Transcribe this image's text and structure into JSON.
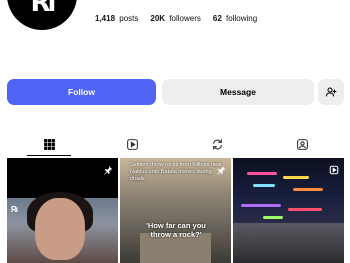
{
  "profile": {
    "avatar_text": "Rı",
    "stats": [
      {
        "value": "1,418",
        "label": "posts"
      },
      {
        "value": "20K",
        "label": "followers"
      },
      {
        "value": "62",
        "label": "following"
      }
    ]
  },
  "actions": {
    "follow_label": "Follow",
    "message_label": "Message"
  },
  "tabs": [
    {
      "icon": "grid-icon",
      "active": true
    },
    {
      "icon": "reels-icon",
      "active": false
    },
    {
      "icon": "reposts-icon",
      "active": false
    },
    {
      "icon": "tagged-icon",
      "active": false
    }
  ],
  "posts": [
    {
      "type": "image",
      "pinned": true,
      "logo": "Rı"
    },
    {
      "type": "image",
      "pinned": true,
      "caption": "Settlers throw rocks from hilltops near Nablus onto Batata homes during rituals",
      "overlay": "'How far can you throw a rock?'"
    },
    {
      "type": "reel",
      "pinned": false
    }
  ],
  "colors": {
    "accent": "#4f63f5",
    "secondary_button": "#eeeeee"
  }
}
